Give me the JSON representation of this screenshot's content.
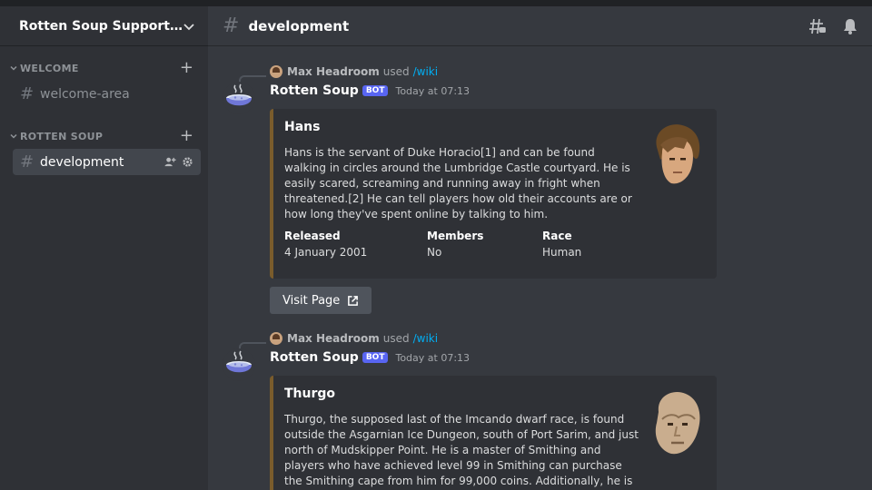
{
  "server": {
    "name": "Rotten Soup Support Se..."
  },
  "categories": [
    {
      "label": "WELCOME",
      "channels": [
        {
          "label": "welcome-area"
        }
      ]
    },
    {
      "label": "ROTTEN SOUP",
      "channels": [
        {
          "label": "development"
        }
      ]
    }
  ],
  "channel": {
    "title": "development"
  },
  "messages": [
    {
      "reply": {
        "user": "Max Headroom",
        "used": "used",
        "command": "/wiki"
      },
      "author": "Rotten Soup",
      "bot_tag": "BOT",
      "timestamp": "Today at 07:13",
      "embed": {
        "title": "Hans",
        "description": "Hans is the servant of Duke Horacio[1] and can be found walking in circles around the Lumbridge Castle courtyard. He is easily scared, screaming and running away in fright when threatened.[2] He can tell players how old their accounts are or how long they've spent online by talking to him.",
        "fields": [
          {
            "name": "Released",
            "value": "4 January 2001"
          },
          {
            "name": "Members",
            "value": "No"
          },
          {
            "name": "Race",
            "value": "Human"
          }
        ]
      },
      "button": "Visit Page"
    },
    {
      "reply": {
        "user": "Max Headroom",
        "used": "used",
        "command": "/wiki"
      },
      "author": "Rotten Soup",
      "bot_tag": "BOT",
      "timestamp": "Today at 07:13",
      "embed": {
        "title": "Thurgo",
        "description": "Thurgo, the supposed last of the Imcando dwarf race, is found outside the Asgarnian Ice Dungeon, south of Port Sarim, and just north of Mudskipper Point. He is a master of Smithing and players who have achieved level 99 in Smithing can purchase the Smithing cape from him for 99,000 coins. Additionally, he is one of the main characters"
      }
    }
  ],
  "colors": {
    "sidebar": "#2f3136",
    "main": "#36393f",
    "embed": "#2f3136",
    "accent": "#5865f2",
    "link": "#00aff4"
  }
}
